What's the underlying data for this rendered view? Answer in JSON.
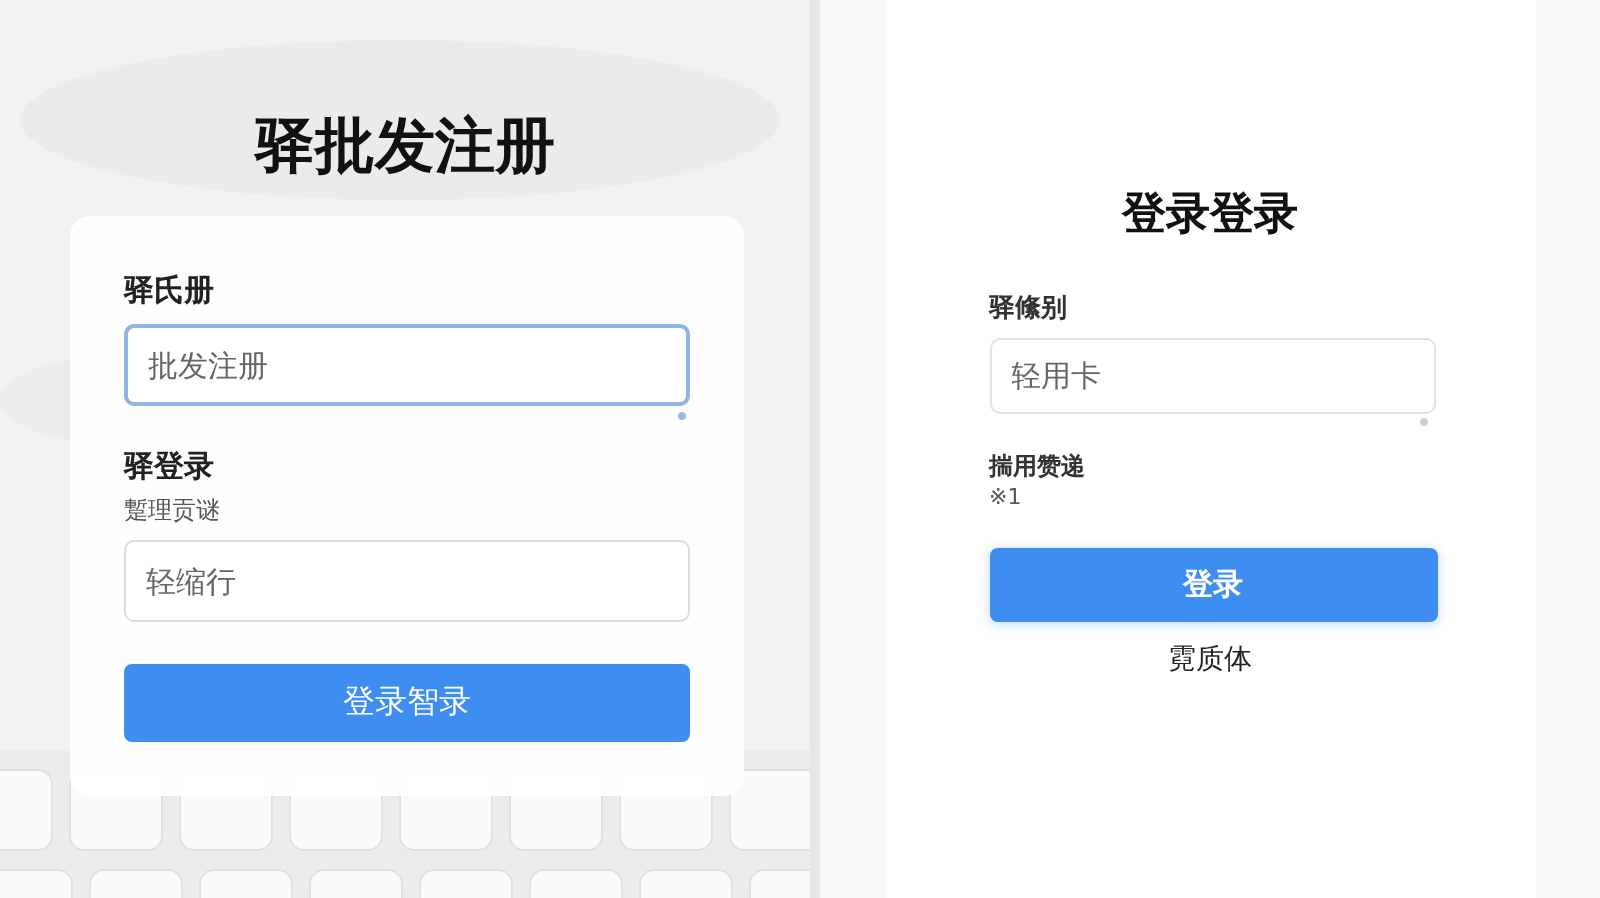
{
  "register_panel": {
    "title": "驿批发注册",
    "fields": [
      {
        "label": "驿氏册",
        "placeholder": "批发注册",
        "focused": true
      },
      {
        "label": "驿登录",
        "hint": "蹔理贡谜",
        "placeholder": "轻缩行",
        "focused": false
      }
    ],
    "button": "登录智录"
  },
  "login_panel": {
    "title": "登录登录",
    "field": {
      "label": "驿絛别",
      "placeholder": "轻用卡"
    },
    "note_label": "揣用赞递",
    "note_value": "※1",
    "button": "登录",
    "link": "霓质体"
  }
}
